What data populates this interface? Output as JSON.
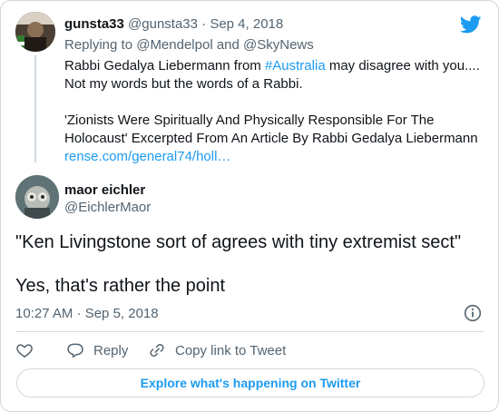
{
  "parent_tweet": {
    "display_name": "gunsta33",
    "handle": "@gunsta33",
    "separator": "·",
    "date": "Sep 4, 2018",
    "replying_to": "Replying to @Mendelpol and @SkyNews",
    "text_line1_pre": "Rabbi Gedalya Liebermann from ",
    "hashtag": "#Australia",
    "text_line1_post": " may disagree with you....",
    "text_line2": "Not my words but the words of a Rabbi.",
    "text_line3": "'Zionists Were Spiritually And  Physically Responsible  For The",
    "text_line4": "Holocaust' Excerpted From An Article By Rabbi Gedalya Liebermann",
    "link": "rense.com/general74/holl…"
  },
  "main_tweet": {
    "display_name": "maor eichler",
    "handle": "@EichlerMaor",
    "text_line1": "\"Ken Livingstone sort of agrees with tiny extremist sect\"",
    "text_line2": "Yes, that's rather the point",
    "timestamp": "10:27 AM · Sep 5, 2018"
  },
  "actions": {
    "reply_label": "Reply",
    "copy_link_label": "Copy link to Tweet"
  },
  "explore_button": "Explore what's happening on Twitter",
  "icons": {
    "brand": "twitter-bird-icon",
    "info": "info-icon",
    "like": "heart-icon",
    "reply": "reply-bubble-icon",
    "copy": "link-icon"
  },
  "colors": {
    "accent": "#1d9bf0",
    "text": "#0f1419",
    "secondary": "#536471",
    "border": "#cfd9de"
  }
}
